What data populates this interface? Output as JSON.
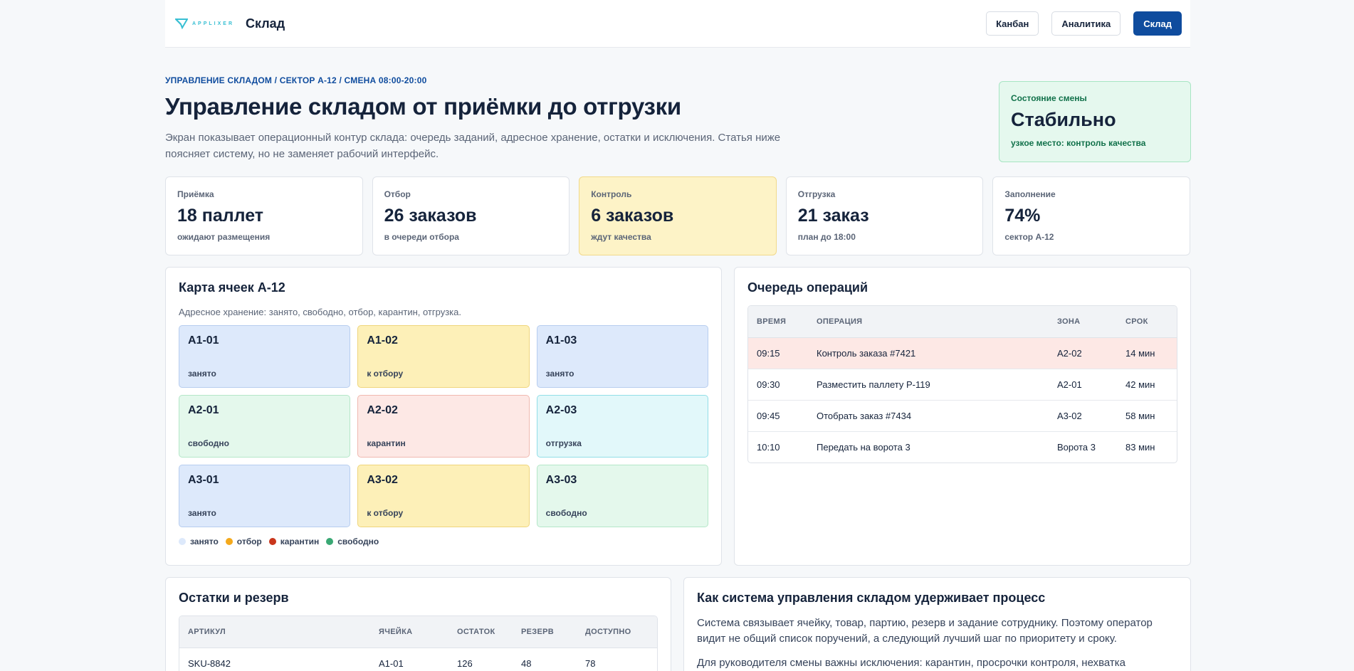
{
  "header": {
    "logo_text": "APPLIXER",
    "title": "Склад",
    "nav": [
      {
        "label": "Канбан",
        "active": false
      },
      {
        "label": "Аналитика",
        "active": false
      },
      {
        "label": "Склад",
        "active": true
      }
    ]
  },
  "hero": {
    "breadcrumb": "УПРАВЛЕНИЕ СКЛАДОМ / СЕКТОР А-12 / СМЕНА 08:00-20:00",
    "title": "Управление складом от приёмки до отгрузки",
    "lead": "Экран показывает операционный контур склада: очередь заданий, адресное хранение, остатки и исключения. Статья ниже поясняет систему, но не заменяет рабочий интерфейс."
  },
  "shift": {
    "label": "Состояние смены",
    "value": "Стабильно",
    "note": "узкое место: контроль качества"
  },
  "kpis": [
    {
      "label": "Приёмка",
      "value": "18 паллет",
      "note": "ожидают размещения",
      "warn": false
    },
    {
      "label": "Отбор",
      "value": "26 заказов",
      "note": "в очереди отбора",
      "warn": false
    },
    {
      "label": "Контроль",
      "value": "6 заказов",
      "note": "ждут качества",
      "warn": true
    },
    {
      "label": "Отгрузка",
      "value": "21 заказ",
      "note": "план до 18:00",
      "warn": false
    },
    {
      "label": "Заполнение",
      "value": "74%",
      "note": "сектор А-12",
      "warn": false
    }
  ],
  "cell_map": {
    "title": "Карта ячеек А-12",
    "subtitle": "Адресное хранение: занято, свободно, отбор, карантин, отгрузка.",
    "cells": [
      {
        "code": "А1-01",
        "state": "занято",
        "kind": "occupied"
      },
      {
        "code": "А1-02",
        "state": "к отбору",
        "kind": "pick"
      },
      {
        "code": "А1-03",
        "state": "занято",
        "kind": "occupied"
      },
      {
        "code": "А2-01",
        "state": "свободно",
        "kind": "free"
      },
      {
        "code": "А2-02",
        "state": "карантин",
        "kind": "quarantine"
      },
      {
        "code": "А2-03",
        "state": "отгрузка",
        "kind": "ship"
      },
      {
        "code": "А3-01",
        "state": "занято",
        "kind": "occupied"
      },
      {
        "code": "А3-02",
        "state": "к отбору",
        "kind": "pick"
      },
      {
        "code": "А3-03",
        "state": "свободно",
        "kind": "free"
      }
    ],
    "legend": [
      {
        "label": "занято",
        "color": "#dde9fb"
      },
      {
        "label": "отбор",
        "color": "#f4a91c"
      },
      {
        "label": "карантин",
        "color": "#c9361c"
      },
      {
        "label": "свободно",
        "color": "#3aa874"
      }
    ]
  },
  "queue": {
    "title": "Очередь операций",
    "columns": [
      "ВРЕМЯ",
      "ОПЕРАЦИЯ",
      "ЗОНА",
      "СРОК"
    ],
    "rows": [
      {
        "time": "09:15",
        "op": "Контроль заказа #7421",
        "zone": "А2-02",
        "due": "14 мин",
        "hot": true
      },
      {
        "time": "09:30",
        "op": "Разместить паллету P-119",
        "zone": "А2-01",
        "due": "42 мин",
        "hot": false
      },
      {
        "time": "09:45",
        "op": "Отобрать заказ #7434",
        "zone": "А3-02",
        "due": "58 мин",
        "hot": false
      },
      {
        "time": "10:10",
        "op": "Передать на ворота 3",
        "zone": "Ворота 3",
        "due": "83 мин",
        "hot": false
      }
    ]
  },
  "stock": {
    "title": "Остатки и резерв",
    "columns": [
      "АРТИКУЛ",
      "ЯЧЕЙКА",
      "ОСТАТОК",
      "РЕЗЕРВ",
      "ДОСТУПНО"
    ],
    "rows": [
      {
        "sku": "SKU-8842",
        "cell": "А1-01",
        "qty": "126",
        "reserve": "48",
        "available": "78"
      }
    ]
  },
  "article": {
    "title": "Как система управления складом удерживает процесс",
    "p1": "Система связывает ячейку, товар, партию, резерв и задание сотруднику. Поэтому оператор видит не общий список поручений, а следующий лучший шаг по приоритету и сроку.",
    "p2": "Для руководителя смены важны исключения: карантин, просрочки контроля, нехватка"
  }
}
